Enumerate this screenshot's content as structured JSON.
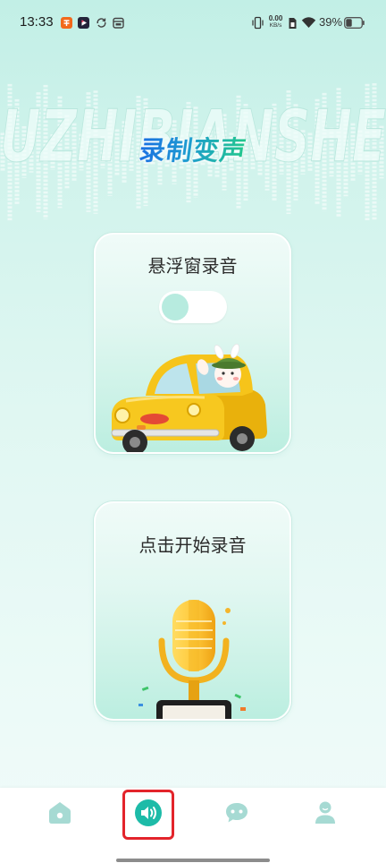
{
  "status_bar": {
    "time": "13:33",
    "left_icons": [
      "orange-app-icon",
      "video-app-icon",
      "sync-icon",
      "calendar-icon"
    ],
    "right_icons": [
      "vibrate-icon",
      "sim-card-icon",
      "wifi-icon",
      "battery-icon"
    ],
    "net_speed": {
      "value": "0.00",
      "unit": "KB/s"
    },
    "battery": {
      "text": "39%",
      "level": 0.39
    }
  },
  "header": {
    "watermark": "UZHIBIANSHE",
    "title": "录制变声"
  },
  "cards": {
    "floating_window": {
      "label": "悬浮窗录音",
      "toggle_on": false,
      "illustration_icon": "yellow-car-icon"
    },
    "start_recording": {
      "label": "点击开始录音",
      "illustration_icon": "microphone-icon"
    }
  },
  "bottom_nav": {
    "items": [
      {
        "icon": "home-icon",
        "active": false
      },
      {
        "icon": "speaker-icon",
        "active": true
      },
      {
        "icon": "chat-icon",
        "active": false
      },
      {
        "icon": "profile-icon",
        "active": false
      }
    ]
  },
  "annotation": {
    "target": "speaker-icon",
    "color": "#e3242b"
  },
  "colors": {
    "accent": "#1dbba8",
    "nav_icon_inactive": "#a6dad3",
    "title_gradient_start": "#1a6fe2",
    "title_gradient_end": "#22c98a",
    "highlight_box": "#e3242b",
    "label_text": "#2b2b2b"
  }
}
